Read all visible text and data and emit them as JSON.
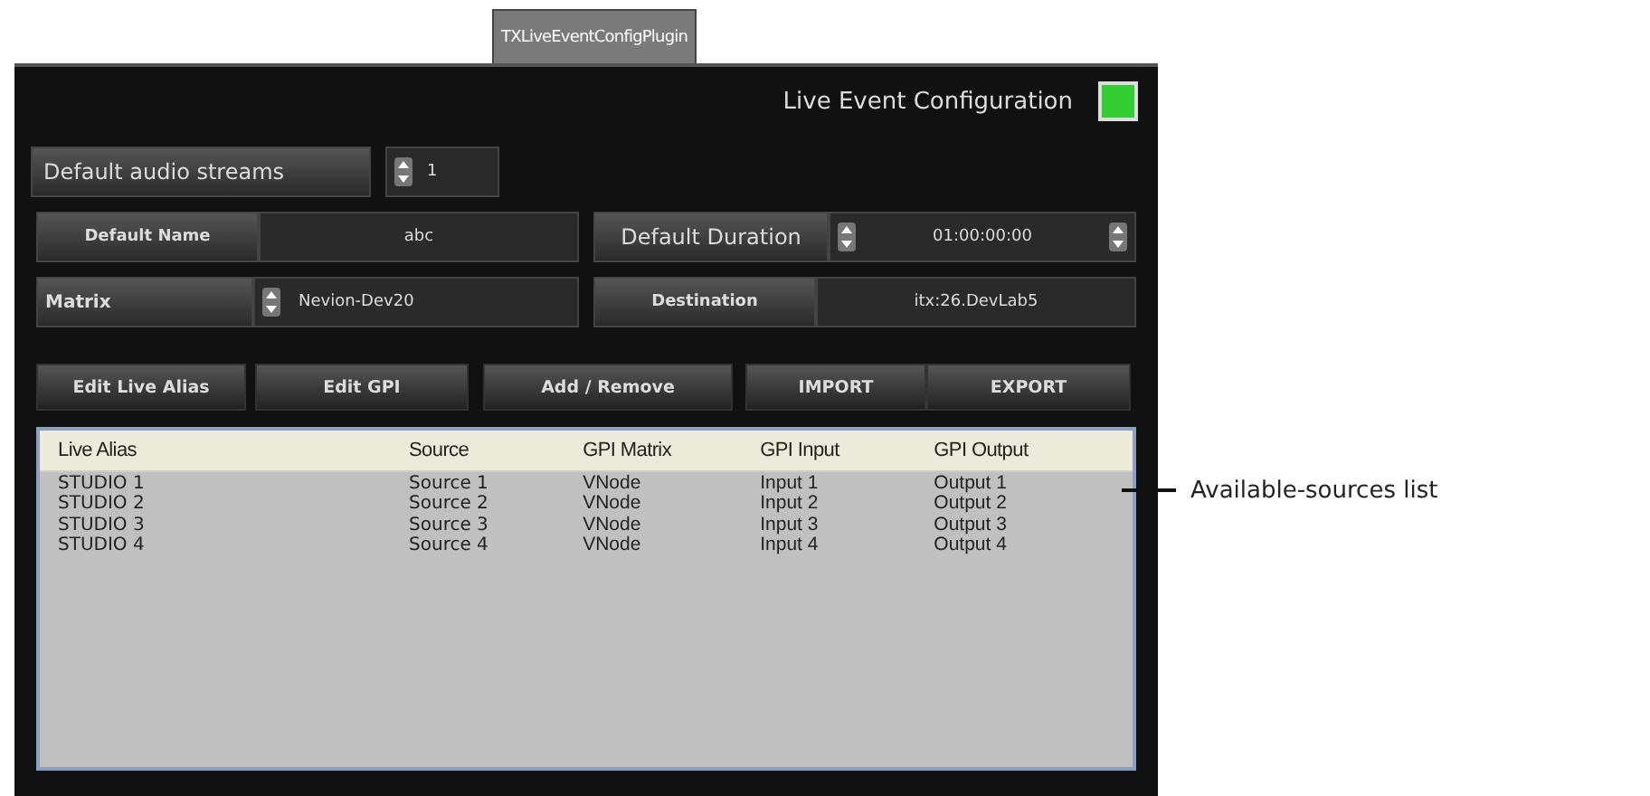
{
  "tab": {
    "label": "TXLiveEventConfigPlugin",
    "selected": true
  },
  "title": "Live Event Configuration",
  "audio_streams": {
    "label": "Default audio streams",
    "value": "1"
  },
  "default_name": {
    "label": "Default Name",
    "value": "abc"
  },
  "default_duration": {
    "label": "Default Duration",
    "value": "01:00:00:00"
  },
  "matrix": {
    "label": "Matrix",
    "value": "Nevion-Dev20"
  },
  "destination": {
    "label": "Destination",
    "value": "itx:26.DevLab5"
  },
  "buttons": [
    "Edit Live Alias",
    "Edit GPI",
    "Add / Remove",
    "IMPORT",
    "EXPORT"
  ],
  "table": {
    "columns": [
      "Live Alias",
      "Source",
      "GPI Matrix",
      "GPI Input",
      "GPI Output"
    ],
    "rows": [
      [
        "STUDIO 1",
        "Source 1",
        "VNode",
        "Input 1",
        "Output 1"
      ],
      [
        "STUDIO 2",
        "Source 2",
        "VNode",
        "Input 2",
        "Output 2"
      ],
      [
        "STUDIO 3",
        "Source 3",
        "VNode",
        "Input 3",
        "Output 3"
      ],
      [
        "STUDIO 4",
        "Source 4",
        "VNode",
        "Input 4",
        "Output 4"
      ]
    ]
  },
  "callout": "Available-sources list"
}
